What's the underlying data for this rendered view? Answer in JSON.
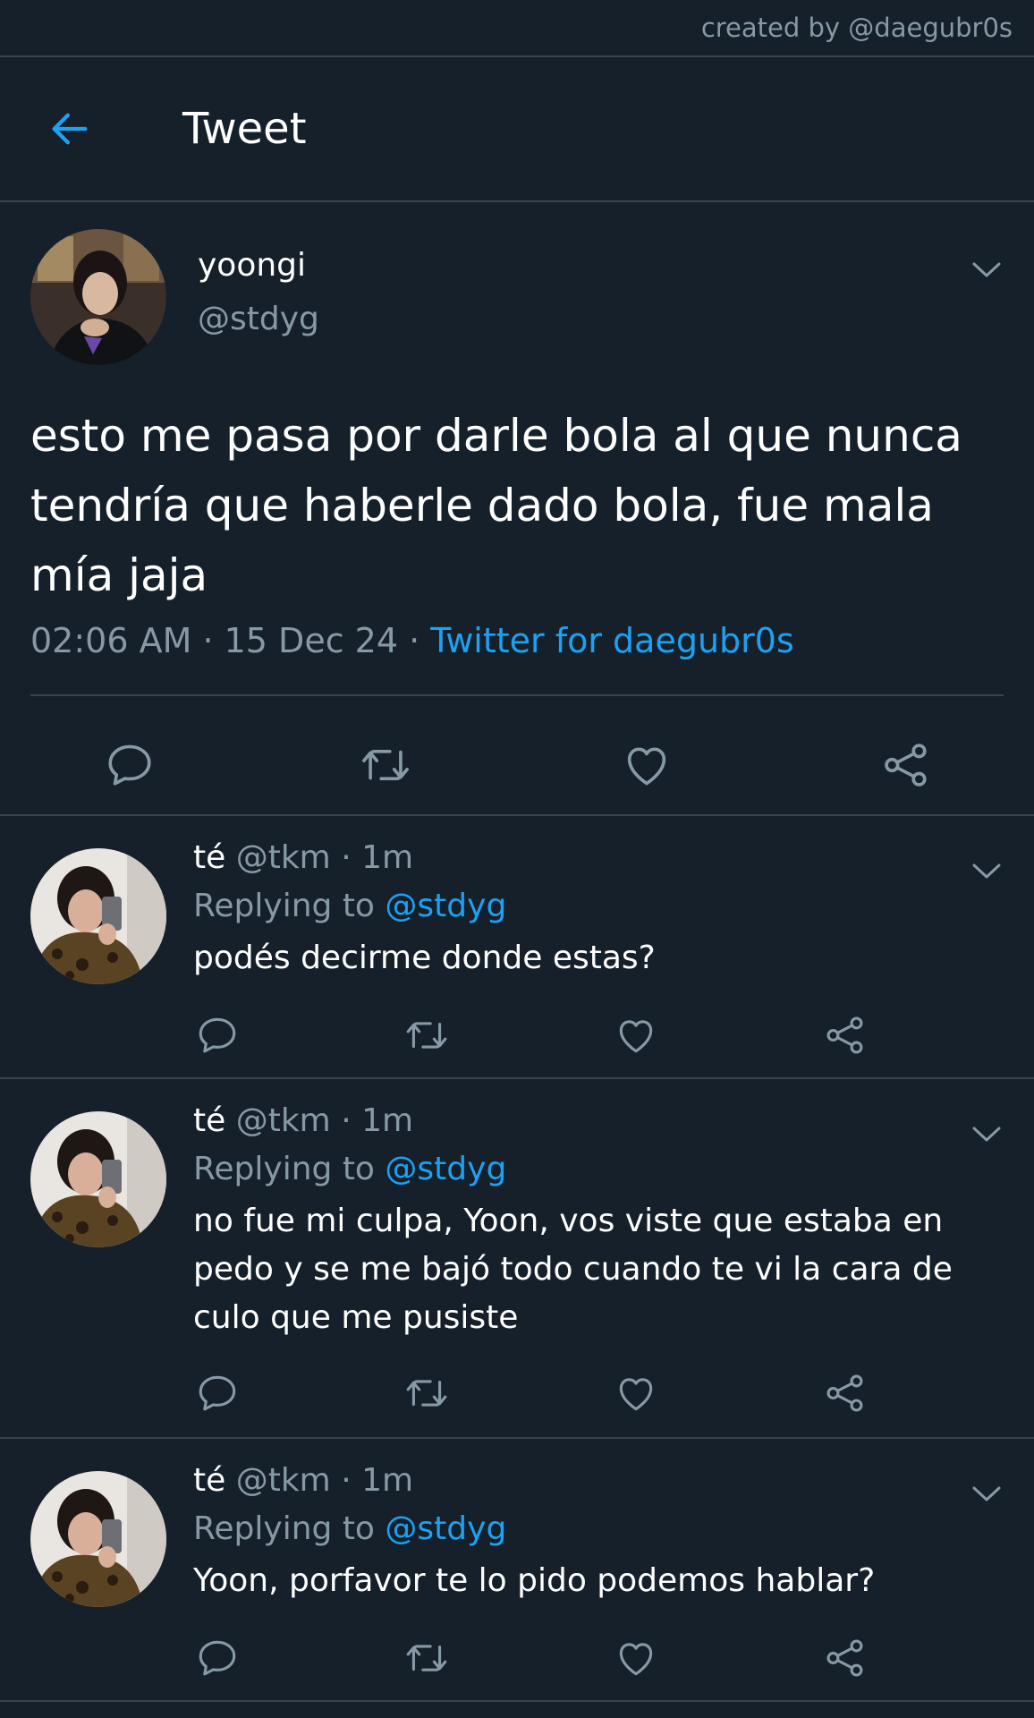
{
  "credit": "created by @daegubr0s",
  "header": {
    "title": "Tweet",
    "back_icon": "arrow-left-icon"
  },
  "colors": {
    "background": "#15202b",
    "accent": "#1da1f2",
    "muted": "#8899a6",
    "divider": "#38444d"
  },
  "main_tweet": {
    "name": "yoongi",
    "handle": "@stdyg",
    "text": "esto me pasa por darle bola al que nunca tendría que haberle dado bola, fue mala mía jaja",
    "time": "02:06 AM",
    "sep1": " · ",
    "date": "15 Dec 24",
    "sep2": " · ",
    "source": "Twitter for daegubr0s"
  },
  "replies": [
    {
      "name": "té",
      "handle": "@tkm",
      "time": "1m",
      "replying_label": "Replying to",
      "replying_handle": "@stdyg",
      "text": "podés decirme donde estas?"
    },
    {
      "name": "té",
      "handle": "@tkm",
      "time": "1m",
      "replying_label": "Replying to",
      "replying_handle": "@stdyg",
      "text": "no fue mi culpa, Yoon, vos viste que estaba en pedo y se me bajó todo cuando te vi la cara de culo que me pusiste"
    },
    {
      "name": "té",
      "handle": "@tkm",
      "time": "1m",
      "replying_label": "Replying to",
      "replying_handle": "@stdyg",
      "text": "Yoon, porfavor te lo pido podemos hablar?"
    }
  ],
  "action_icons": [
    "reply-icon",
    "retweet-icon",
    "like-icon",
    "share-icon"
  ]
}
